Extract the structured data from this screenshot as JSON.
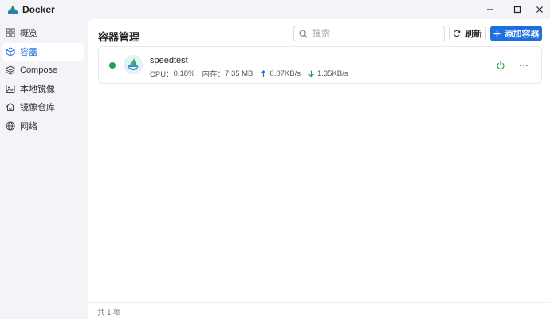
{
  "window": {
    "title": "Docker",
    "logo_icon": "docker-whale-icon"
  },
  "sidebar": {
    "items": [
      {
        "label": "概览",
        "icon": "grid-icon",
        "active": false
      },
      {
        "label": "容器",
        "icon": "cube-icon",
        "active": true
      },
      {
        "label": "Compose",
        "icon": "layers-icon",
        "active": false
      },
      {
        "label": "本地镜像",
        "icon": "image-icon",
        "active": false
      },
      {
        "label": "镜像仓库",
        "icon": "home-icon",
        "active": false
      },
      {
        "label": "网络",
        "icon": "globe-icon",
        "active": false
      }
    ]
  },
  "main": {
    "title": "容器管理",
    "search_placeholder": "搜索",
    "refresh_label": "刷新",
    "add_label": "添加容器",
    "containers": [
      {
        "name": "speedtest",
        "status": "running",
        "cpu_label": "CPU：",
        "cpu": "0.18%",
        "mem_label": "内存：",
        "mem": "7.35 MB",
        "upload": "0.07KB/s",
        "download": "1.35KB/s"
      }
    ],
    "footer": "共 1 项"
  },
  "colors": {
    "accent": "#1e6fe0",
    "running": "#1aa34a",
    "sidebar_bg": "#f2f4f7",
    "content_bg": "#ffffff"
  }
}
